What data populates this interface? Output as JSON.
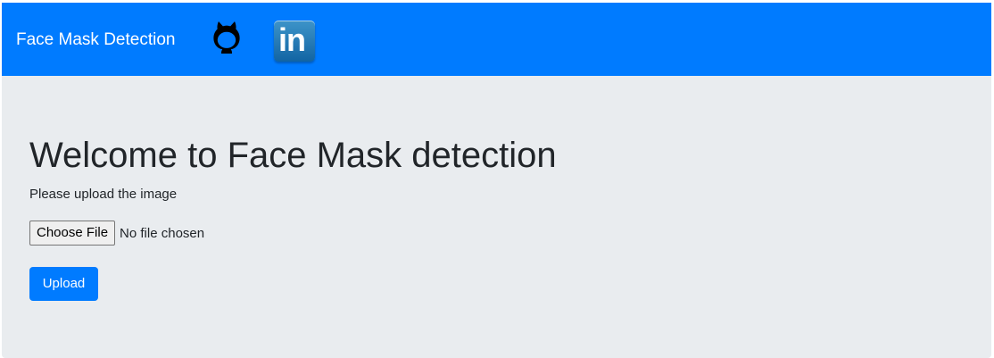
{
  "navbar": {
    "brand": "Face Mask Detection",
    "links": [
      {
        "icon": "github-icon"
      },
      {
        "icon": "linkedin-icon",
        "text": "in"
      }
    ],
    "background_color": "#007bff"
  },
  "main": {
    "title": "Welcome to Face Mask detection",
    "instruction": "Please upload the image",
    "file_input": {
      "button_label": "Choose File",
      "status": "No file chosen"
    },
    "upload_button": {
      "label": "Upload"
    },
    "background_color": "#e9ecef"
  },
  "colors": {
    "primary": "#007bff",
    "text": "#212529"
  }
}
